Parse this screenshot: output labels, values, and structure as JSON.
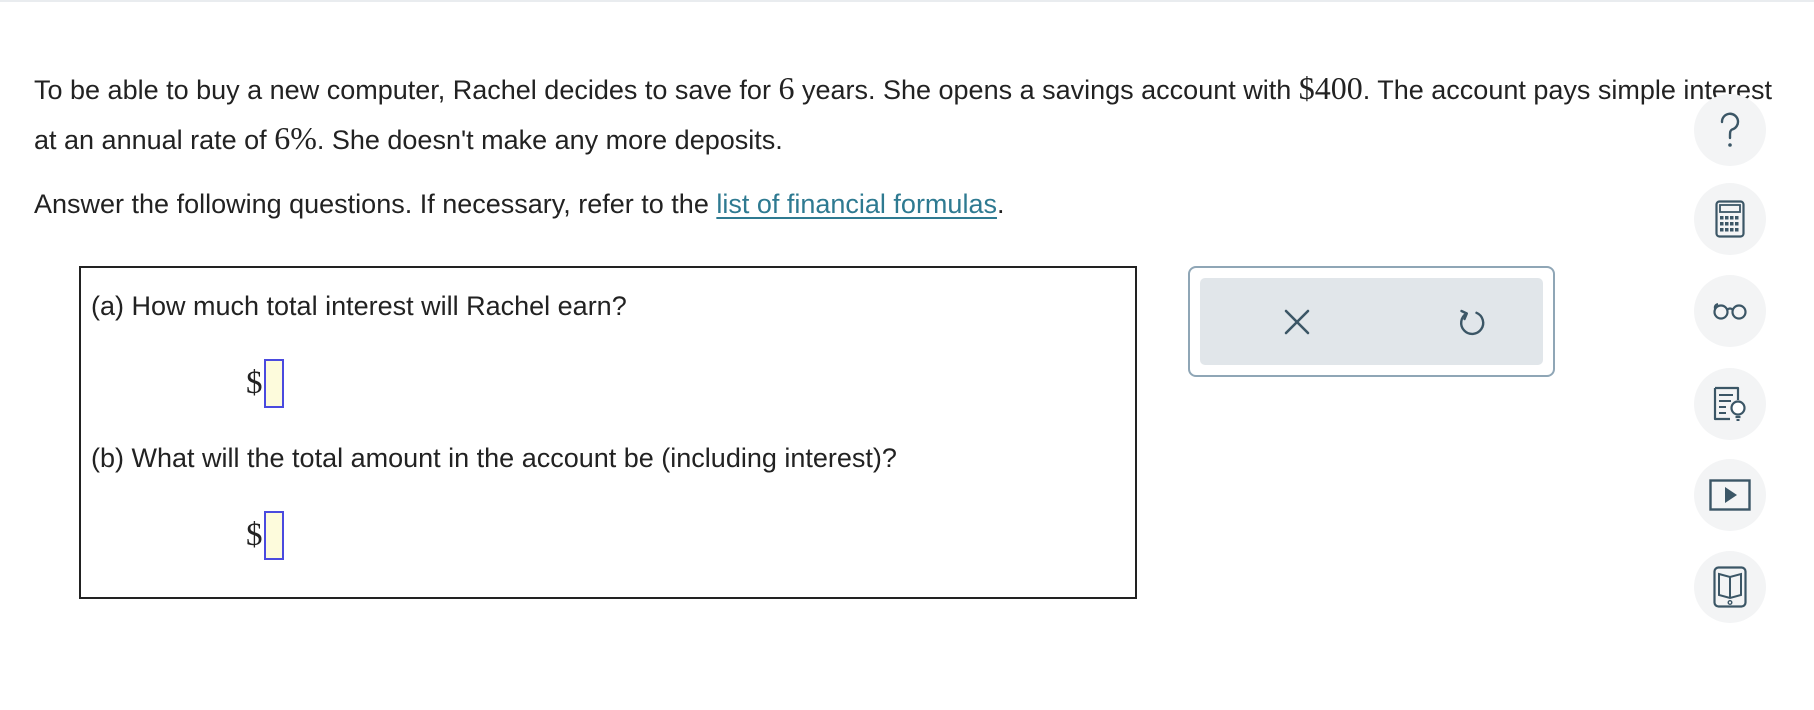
{
  "problem": {
    "part1": "To be able to buy a new computer, Rachel decides to save for ",
    "years": "6",
    "part2": " years. She opens a savings account with ",
    "deposit": "$400",
    "part3": ". The account pays simple interest at an annual rate of ",
    "rate": "6%",
    "part4": ". She doesn't make any more deposits."
  },
  "instructions": {
    "text": "Answer the following questions. If necessary, refer to the ",
    "link_label": "list of financial formulas",
    "end": "."
  },
  "questions": [
    {
      "label": "(a) How much total interest will Rachel earn?",
      "currency": "$",
      "value": ""
    },
    {
      "label": "(b) What will the total amount in the account be (including interest)?",
      "currency": "$",
      "value": ""
    }
  ],
  "tool_panel": {
    "buttons": [
      {
        "icon": "close-icon"
      },
      {
        "icon": "undo-icon"
      }
    ]
  },
  "sidebar": {
    "buttons": [
      {
        "icon": "help-icon"
      },
      {
        "icon": "calculator-icon"
      },
      {
        "icon": "glasses-icon"
      },
      {
        "icon": "notes-lightbulb-icon"
      },
      {
        "icon": "video-play-icon"
      },
      {
        "icon": "ebook-icon"
      }
    ]
  },
  "colors": {
    "link": "#2e7a91",
    "input_border": "#4a4adf",
    "input_bg": "#fdfbdc",
    "panel_border": "#8fa6b6",
    "panel_fill": "#e1e6ea",
    "icon": "#3b5666",
    "side_button_bg": "#f3f4f5"
  }
}
